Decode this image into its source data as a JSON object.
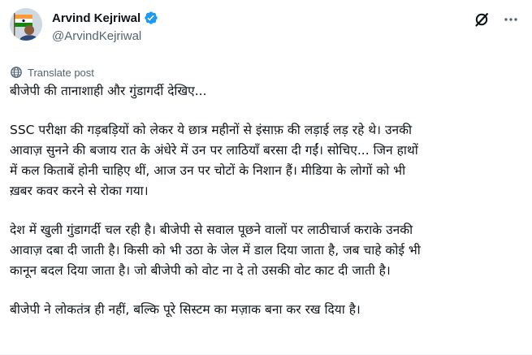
{
  "post": {
    "author": {
      "display_name": "Arvind Kejriwal",
      "handle": "@ArvindKejriwal",
      "verified": true
    },
    "top_actions": {
      "grok_icon": "grok-slash-icon",
      "more_icon": "more-dots-icon"
    },
    "translate": {
      "icon": "globe-icon",
      "label": "Translate post"
    },
    "paragraphs": [
      {
        "lines": [
          "बीजेपी की तानाशाही और गुंडागर्दी देखिए..."
        ]
      },
      {
        "lines": [
          "SSC परीक्षा की गड़बड़ियों को लेकर ये छात्र महीनों से इंसाफ़ की लड़ाई लड़ रहे थे। उनकी",
          "आवाज़ सुनने की बजाय रात के अंधेरे में उन पर लाठियाँ बरसा दी गईं। सोचिए... जिन हाथों",
          "में कल किताबें होनी चाहिए थीं, आज उन पर चोटों के निशान हैं। मीडिया के लोगों को भी",
          "ख़बर कवर करने से रोका गया।"
        ]
      },
      {
        "lines": [
          "देश में खुली गुंडागर्दी चल रही है। बीजेपी से सवाल पूछने वालों पर लाठीचार्ज कराके उनकी",
          "आवाज़ दबा दी जाती है। किसी को भी उठा के जेल में डाल दिया जाता है, जब चाहे कोई भी",
          "कानून बदल दिया जाता है। जो बीजेपी को वोट ना दे तो उसकी वोट काट दी जाती है।"
        ]
      },
      {
        "lines": [
          "बीजेपी ने लोकतंत्र ही नहीं, बल्कि पूरे सिस्टम का मज़ाक बना कर रख दिया है।"
        ]
      }
    ],
    "colors": {
      "text": "#0f1419",
      "secondary": "#536471",
      "verified": "#1d9bf0"
    }
  }
}
